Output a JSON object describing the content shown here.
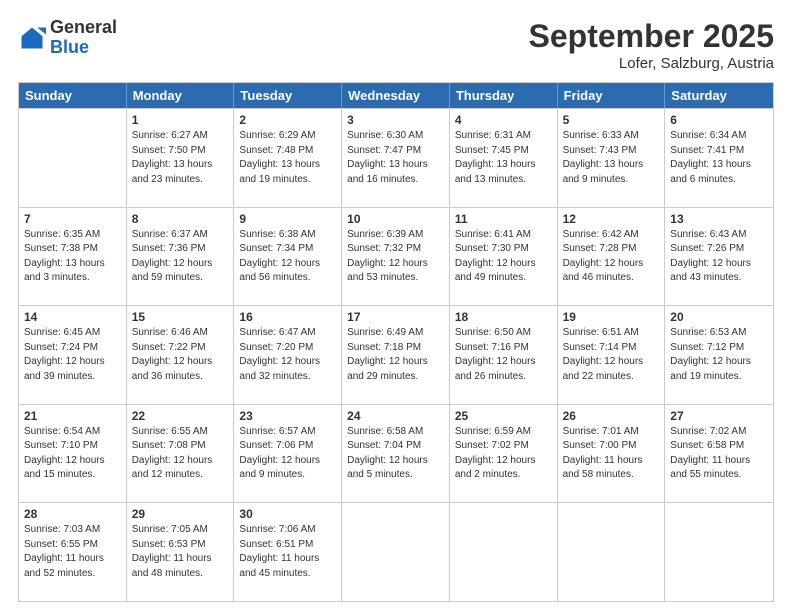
{
  "header": {
    "logo_general": "General",
    "logo_blue": "Blue",
    "month": "September 2025",
    "location": "Lofer, Salzburg, Austria"
  },
  "weekdays": [
    "Sunday",
    "Monday",
    "Tuesday",
    "Wednesday",
    "Thursday",
    "Friday",
    "Saturday"
  ],
  "weeks": [
    [
      {
        "day": "",
        "sunrise": "",
        "sunset": "",
        "daylight": ""
      },
      {
        "day": "1",
        "sunrise": "Sunrise: 6:27 AM",
        "sunset": "Sunset: 7:50 PM",
        "daylight": "Daylight: 13 hours and 23 minutes."
      },
      {
        "day": "2",
        "sunrise": "Sunrise: 6:29 AM",
        "sunset": "Sunset: 7:48 PM",
        "daylight": "Daylight: 13 hours and 19 minutes."
      },
      {
        "day": "3",
        "sunrise": "Sunrise: 6:30 AM",
        "sunset": "Sunset: 7:47 PM",
        "daylight": "Daylight: 13 hours and 16 minutes."
      },
      {
        "day": "4",
        "sunrise": "Sunrise: 6:31 AM",
        "sunset": "Sunset: 7:45 PM",
        "daylight": "Daylight: 13 hours and 13 minutes."
      },
      {
        "day": "5",
        "sunrise": "Sunrise: 6:33 AM",
        "sunset": "Sunset: 7:43 PM",
        "daylight": "Daylight: 13 hours and 9 minutes."
      },
      {
        "day": "6",
        "sunrise": "Sunrise: 6:34 AM",
        "sunset": "Sunset: 7:41 PM",
        "daylight": "Daylight: 13 hours and 6 minutes."
      }
    ],
    [
      {
        "day": "7",
        "sunrise": "Sunrise: 6:35 AM",
        "sunset": "Sunset: 7:38 PM",
        "daylight": "Daylight: 13 hours and 3 minutes."
      },
      {
        "day": "8",
        "sunrise": "Sunrise: 6:37 AM",
        "sunset": "Sunset: 7:36 PM",
        "daylight": "Daylight: 12 hours and 59 minutes."
      },
      {
        "day": "9",
        "sunrise": "Sunrise: 6:38 AM",
        "sunset": "Sunset: 7:34 PM",
        "daylight": "Daylight: 12 hours and 56 minutes."
      },
      {
        "day": "10",
        "sunrise": "Sunrise: 6:39 AM",
        "sunset": "Sunset: 7:32 PM",
        "daylight": "Daylight: 12 hours and 53 minutes."
      },
      {
        "day": "11",
        "sunrise": "Sunrise: 6:41 AM",
        "sunset": "Sunset: 7:30 PM",
        "daylight": "Daylight: 12 hours and 49 minutes."
      },
      {
        "day": "12",
        "sunrise": "Sunrise: 6:42 AM",
        "sunset": "Sunset: 7:28 PM",
        "daylight": "Daylight: 12 hours and 46 minutes."
      },
      {
        "day": "13",
        "sunrise": "Sunrise: 6:43 AM",
        "sunset": "Sunset: 7:26 PM",
        "daylight": "Daylight: 12 hours and 43 minutes."
      }
    ],
    [
      {
        "day": "14",
        "sunrise": "Sunrise: 6:45 AM",
        "sunset": "Sunset: 7:24 PM",
        "daylight": "Daylight: 12 hours and 39 minutes."
      },
      {
        "day": "15",
        "sunrise": "Sunrise: 6:46 AM",
        "sunset": "Sunset: 7:22 PM",
        "daylight": "Daylight: 12 hours and 36 minutes."
      },
      {
        "day": "16",
        "sunrise": "Sunrise: 6:47 AM",
        "sunset": "Sunset: 7:20 PM",
        "daylight": "Daylight: 12 hours and 32 minutes."
      },
      {
        "day": "17",
        "sunrise": "Sunrise: 6:49 AM",
        "sunset": "Sunset: 7:18 PM",
        "daylight": "Daylight: 12 hours and 29 minutes."
      },
      {
        "day": "18",
        "sunrise": "Sunrise: 6:50 AM",
        "sunset": "Sunset: 7:16 PM",
        "daylight": "Daylight: 12 hours and 26 minutes."
      },
      {
        "day": "19",
        "sunrise": "Sunrise: 6:51 AM",
        "sunset": "Sunset: 7:14 PM",
        "daylight": "Daylight: 12 hours and 22 minutes."
      },
      {
        "day": "20",
        "sunrise": "Sunrise: 6:53 AM",
        "sunset": "Sunset: 7:12 PM",
        "daylight": "Daylight: 12 hours and 19 minutes."
      }
    ],
    [
      {
        "day": "21",
        "sunrise": "Sunrise: 6:54 AM",
        "sunset": "Sunset: 7:10 PM",
        "daylight": "Daylight: 12 hours and 15 minutes."
      },
      {
        "day": "22",
        "sunrise": "Sunrise: 6:55 AM",
        "sunset": "Sunset: 7:08 PM",
        "daylight": "Daylight: 12 hours and 12 minutes."
      },
      {
        "day": "23",
        "sunrise": "Sunrise: 6:57 AM",
        "sunset": "Sunset: 7:06 PM",
        "daylight": "Daylight: 12 hours and 9 minutes."
      },
      {
        "day": "24",
        "sunrise": "Sunrise: 6:58 AM",
        "sunset": "Sunset: 7:04 PM",
        "daylight": "Daylight: 12 hours and 5 minutes."
      },
      {
        "day": "25",
        "sunrise": "Sunrise: 6:59 AM",
        "sunset": "Sunset: 7:02 PM",
        "daylight": "Daylight: 12 hours and 2 minutes."
      },
      {
        "day": "26",
        "sunrise": "Sunrise: 7:01 AM",
        "sunset": "Sunset: 7:00 PM",
        "daylight": "Daylight: 11 hours and 58 minutes."
      },
      {
        "day": "27",
        "sunrise": "Sunrise: 7:02 AM",
        "sunset": "Sunset: 6:58 PM",
        "daylight": "Daylight: 11 hours and 55 minutes."
      }
    ],
    [
      {
        "day": "28",
        "sunrise": "Sunrise: 7:03 AM",
        "sunset": "Sunset: 6:55 PM",
        "daylight": "Daylight: 11 hours and 52 minutes."
      },
      {
        "day": "29",
        "sunrise": "Sunrise: 7:05 AM",
        "sunset": "Sunset: 6:53 PM",
        "daylight": "Daylight: 11 hours and 48 minutes."
      },
      {
        "day": "30",
        "sunrise": "Sunrise: 7:06 AM",
        "sunset": "Sunset: 6:51 PM",
        "daylight": "Daylight: 11 hours and 45 minutes."
      },
      {
        "day": "",
        "sunrise": "",
        "sunset": "",
        "daylight": ""
      },
      {
        "day": "",
        "sunrise": "",
        "sunset": "",
        "daylight": ""
      },
      {
        "day": "",
        "sunrise": "",
        "sunset": "",
        "daylight": ""
      },
      {
        "day": "",
        "sunrise": "",
        "sunset": "",
        "daylight": ""
      }
    ]
  ]
}
